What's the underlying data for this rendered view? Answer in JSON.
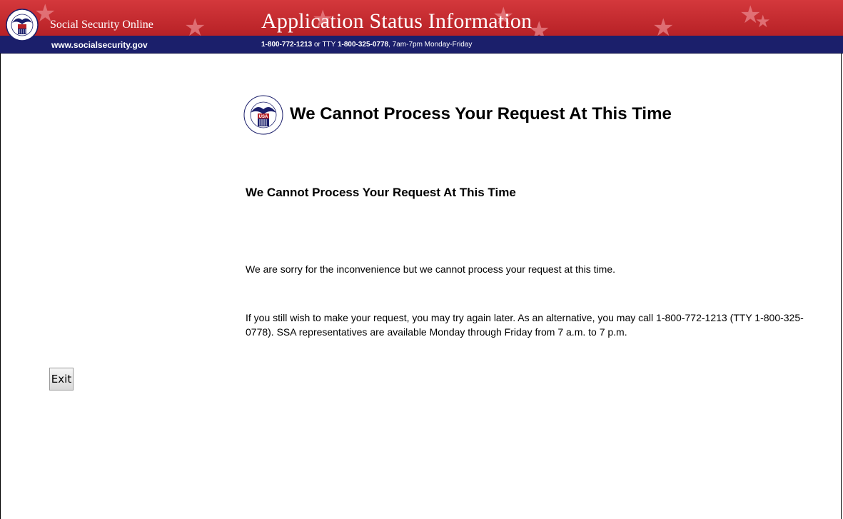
{
  "header": {
    "site_name": "Social Security Online",
    "site_url": "www.socialsecurity.gov",
    "app_title": "Application Status Information",
    "phone_main": "1-800-772-1213",
    "phone_or": " or TTY ",
    "phone_tty": "1-800-325-0778",
    "phone_hours": ", 7am-7pm Monday-Friday",
    "seal_text": "SOCIAL SECURITY ADMINISTRATION",
    "seal_badge": "USA",
    "colors": {
      "red": "#c12b30",
      "navy": "#1b1f6b"
    }
  },
  "main": {
    "heading": "We Cannot Process Your Request At This Time",
    "subheading": "We Cannot Process Your Request At This Time",
    "paragraph1": "We are sorry for the inconvenience but we cannot process your request at this time.",
    "paragraph2": "If you still wish to make your request, you may try again later. As an alternative, you may call 1-800-772-1213 (TTY 1-800-325-0778). SSA representatives are available Monday through Friday from 7 a.m. to 7 p.m."
  },
  "actions": {
    "exit_label": "Exit"
  }
}
